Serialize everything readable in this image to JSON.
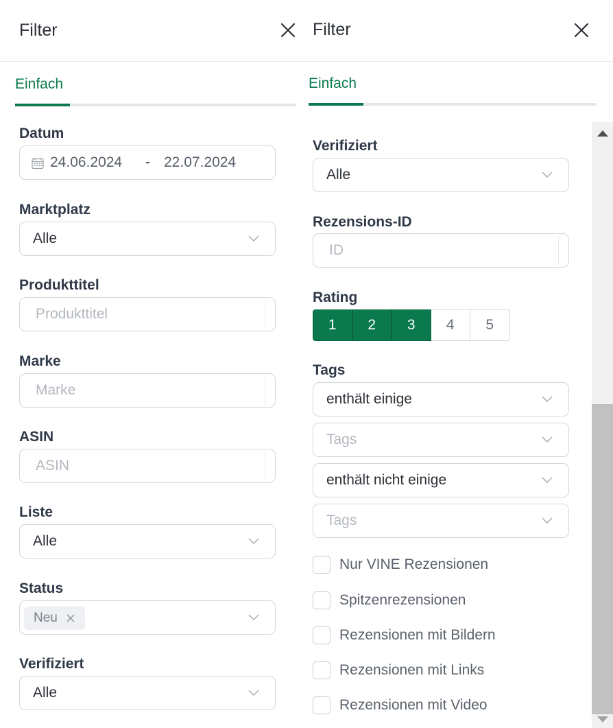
{
  "left_panel": {
    "title": "Filter",
    "tab": "Einfach",
    "fields": {
      "datum_label": "Datum",
      "date_from": "24.06.2024",
      "date_sep": "-",
      "date_to": "22.07.2024",
      "marktplatz_label": "Marktplatz",
      "marktplatz_value": "Alle",
      "produkttitel_label": "Produkttitel",
      "produkttitel_placeholder": "Produkttitel",
      "marke_label": "Marke",
      "marke_placeholder": "Marke",
      "asin_label": "ASIN",
      "asin_placeholder": "ASIN",
      "liste_label": "Liste",
      "liste_value": "Alle",
      "status_label": "Status",
      "status_chip": "Neu",
      "verifiziert_label": "Verifiziert",
      "verifiziert_value": "Alle"
    }
  },
  "right_panel": {
    "title": "Filter",
    "tab": "Einfach",
    "fields": {
      "verifiziert_label": "Verifiziert",
      "verifiziert_value": "Alle",
      "rezensions_id_label": "Rezensions-ID",
      "rezensions_id_placeholder": "ID",
      "rating_label": "Rating",
      "rating_options": [
        "1",
        "2",
        "3",
        "4",
        "5"
      ],
      "rating_selected": [
        "1",
        "2",
        "3"
      ],
      "tags_label": "Tags",
      "tags_include_mode": "enthält einige",
      "tags_include_placeholder": "Tags",
      "tags_exclude_mode": "enthält nicht einige",
      "tags_exclude_placeholder": "Tags"
    },
    "checkboxes": [
      "Nur VINE Rezensionen",
      "Spitzenrezensionen",
      "Rezensionen mit Bildern",
      "Rezensionen mit Links",
      "Rezensionen mit Video"
    ]
  },
  "colors": {
    "accent": "#0a7a4e",
    "border": "#d3d6da",
    "placeholder": "#b3b8bf"
  }
}
